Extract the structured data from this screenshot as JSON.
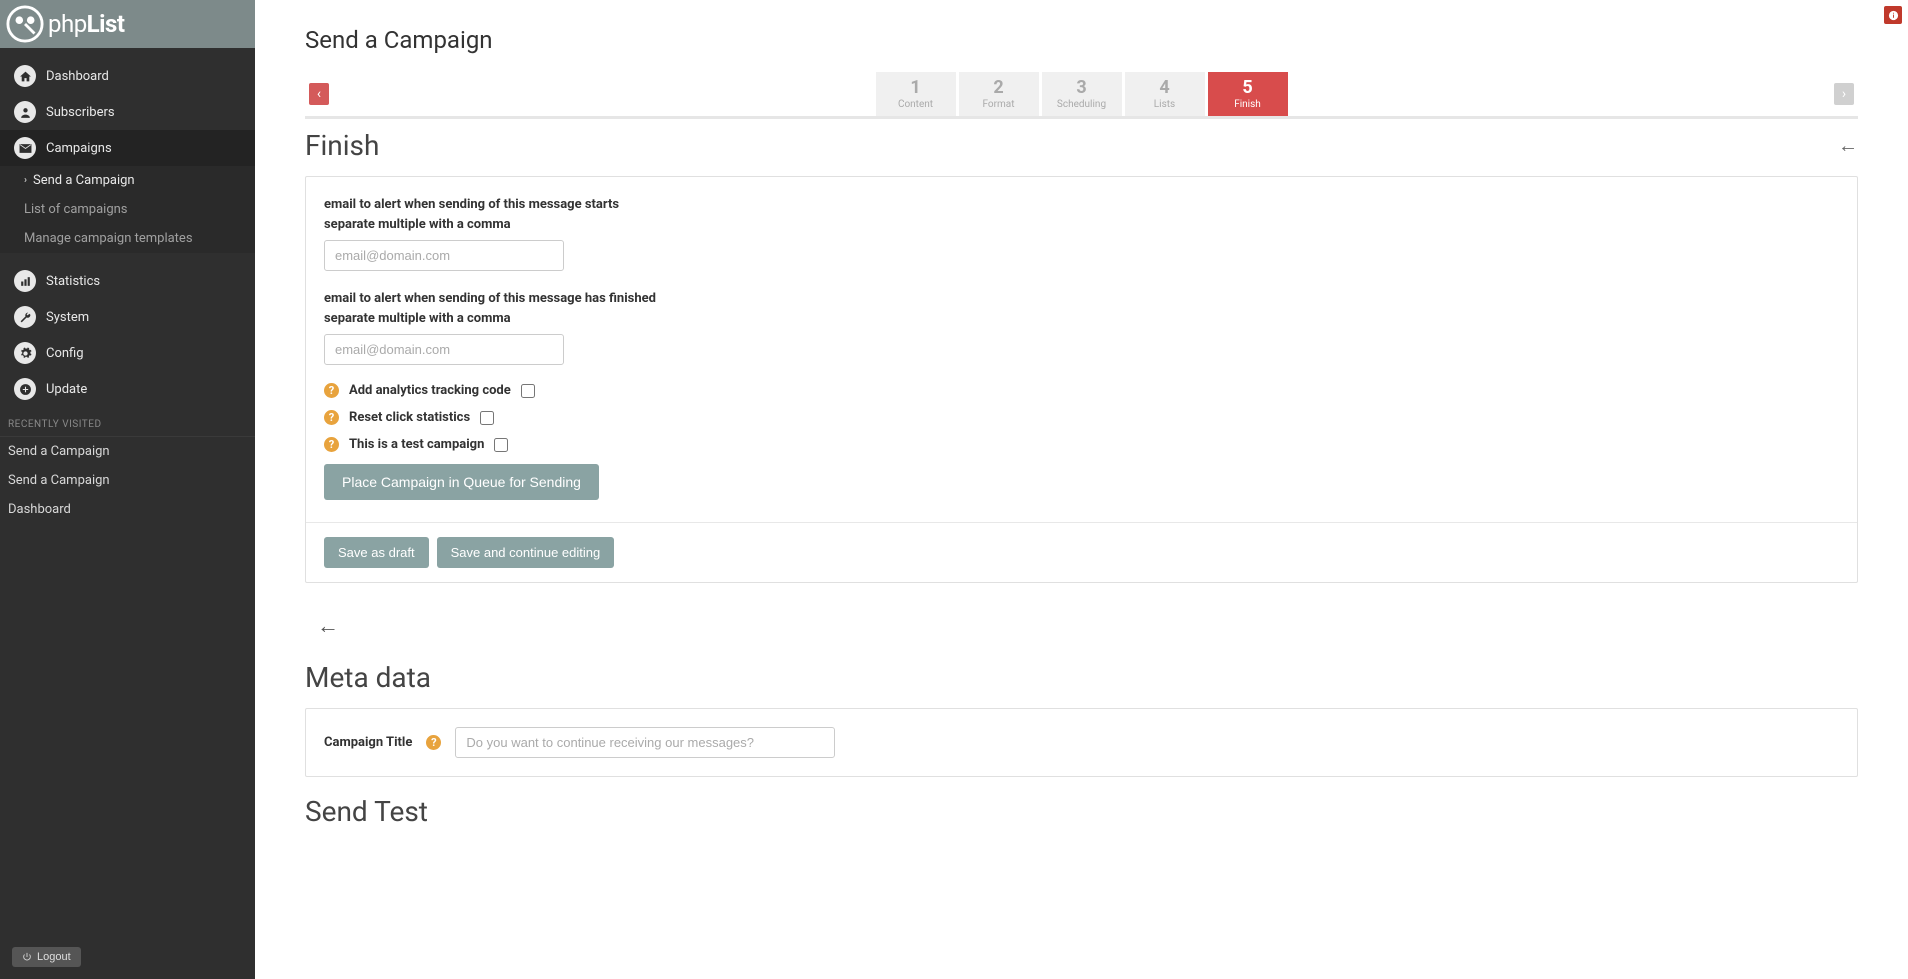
{
  "brand": "phpList",
  "sidebar": {
    "items": [
      {
        "label": "Dashboard"
      },
      {
        "label": "Subscribers"
      },
      {
        "label": "Campaigns"
      },
      {
        "label": "Statistics"
      },
      {
        "label": "System"
      },
      {
        "label": "Config"
      },
      {
        "label": "Update"
      }
    ],
    "campaigns_sub": [
      {
        "label": "Send a Campaign"
      },
      {
        "label": "List of campaigns"
      },
      {
        "label": "Manage campaign templates"
      }
    ],
    "recent_header": "RECENTLY VISITED",
    "recent": [
      {
        "label": "Send a Campaign"
      },
      {
        "label": "Send a Campaign"
      },
      {
        "label": "Dashboard"
      }
    ],
    "logout": "Logout"
  },
  "page": {
    "title": "Send a Campaign",
    "steps": [
      {
        "num": "1",
        "label": "Content"
      },
      {
        "num": "2",
        "label": "Format"
      },
      {
        "num": "3",
        "label": "Scheduling"
      },
      {
        "num": "4",
        "label": "Lists"
      },
      {
        "num": "5",
        "label": "Finish"
      }
    ],
    "section_title": "Finish",
    "alert_start_label": "email to alert when sending of this message starts",
    "alert_start_sub": "separate multiple with a comma",
    "alert_start_placeholder": "email@domain.com",
    "alert_finish_label": "email to alert when sending of this message has finished",
    "alert_finish_sub": "separate multiple with a comma",
    "alert_finish_placeholder": "email@domain.com",
    "analytics_label": "Add analytics tracking code",
    "reset_clicks_label": "Reset click statistics",
    "test_campaign_label": "This is a test campaign",
    "place_queue_btn": "Place Campaign in Queue for Sending",
    "save_draft_btn": "Save as draft",
    "save_continue_btn": "Save and continue editing",
    "meta_title": "Meta data",
    "campaign_title_label": "Campaign Title",
    "campaign_title_placeholder": "Do you want to continue receiving our messages?",
    "send_test_title": "Send Test"
  }
}
